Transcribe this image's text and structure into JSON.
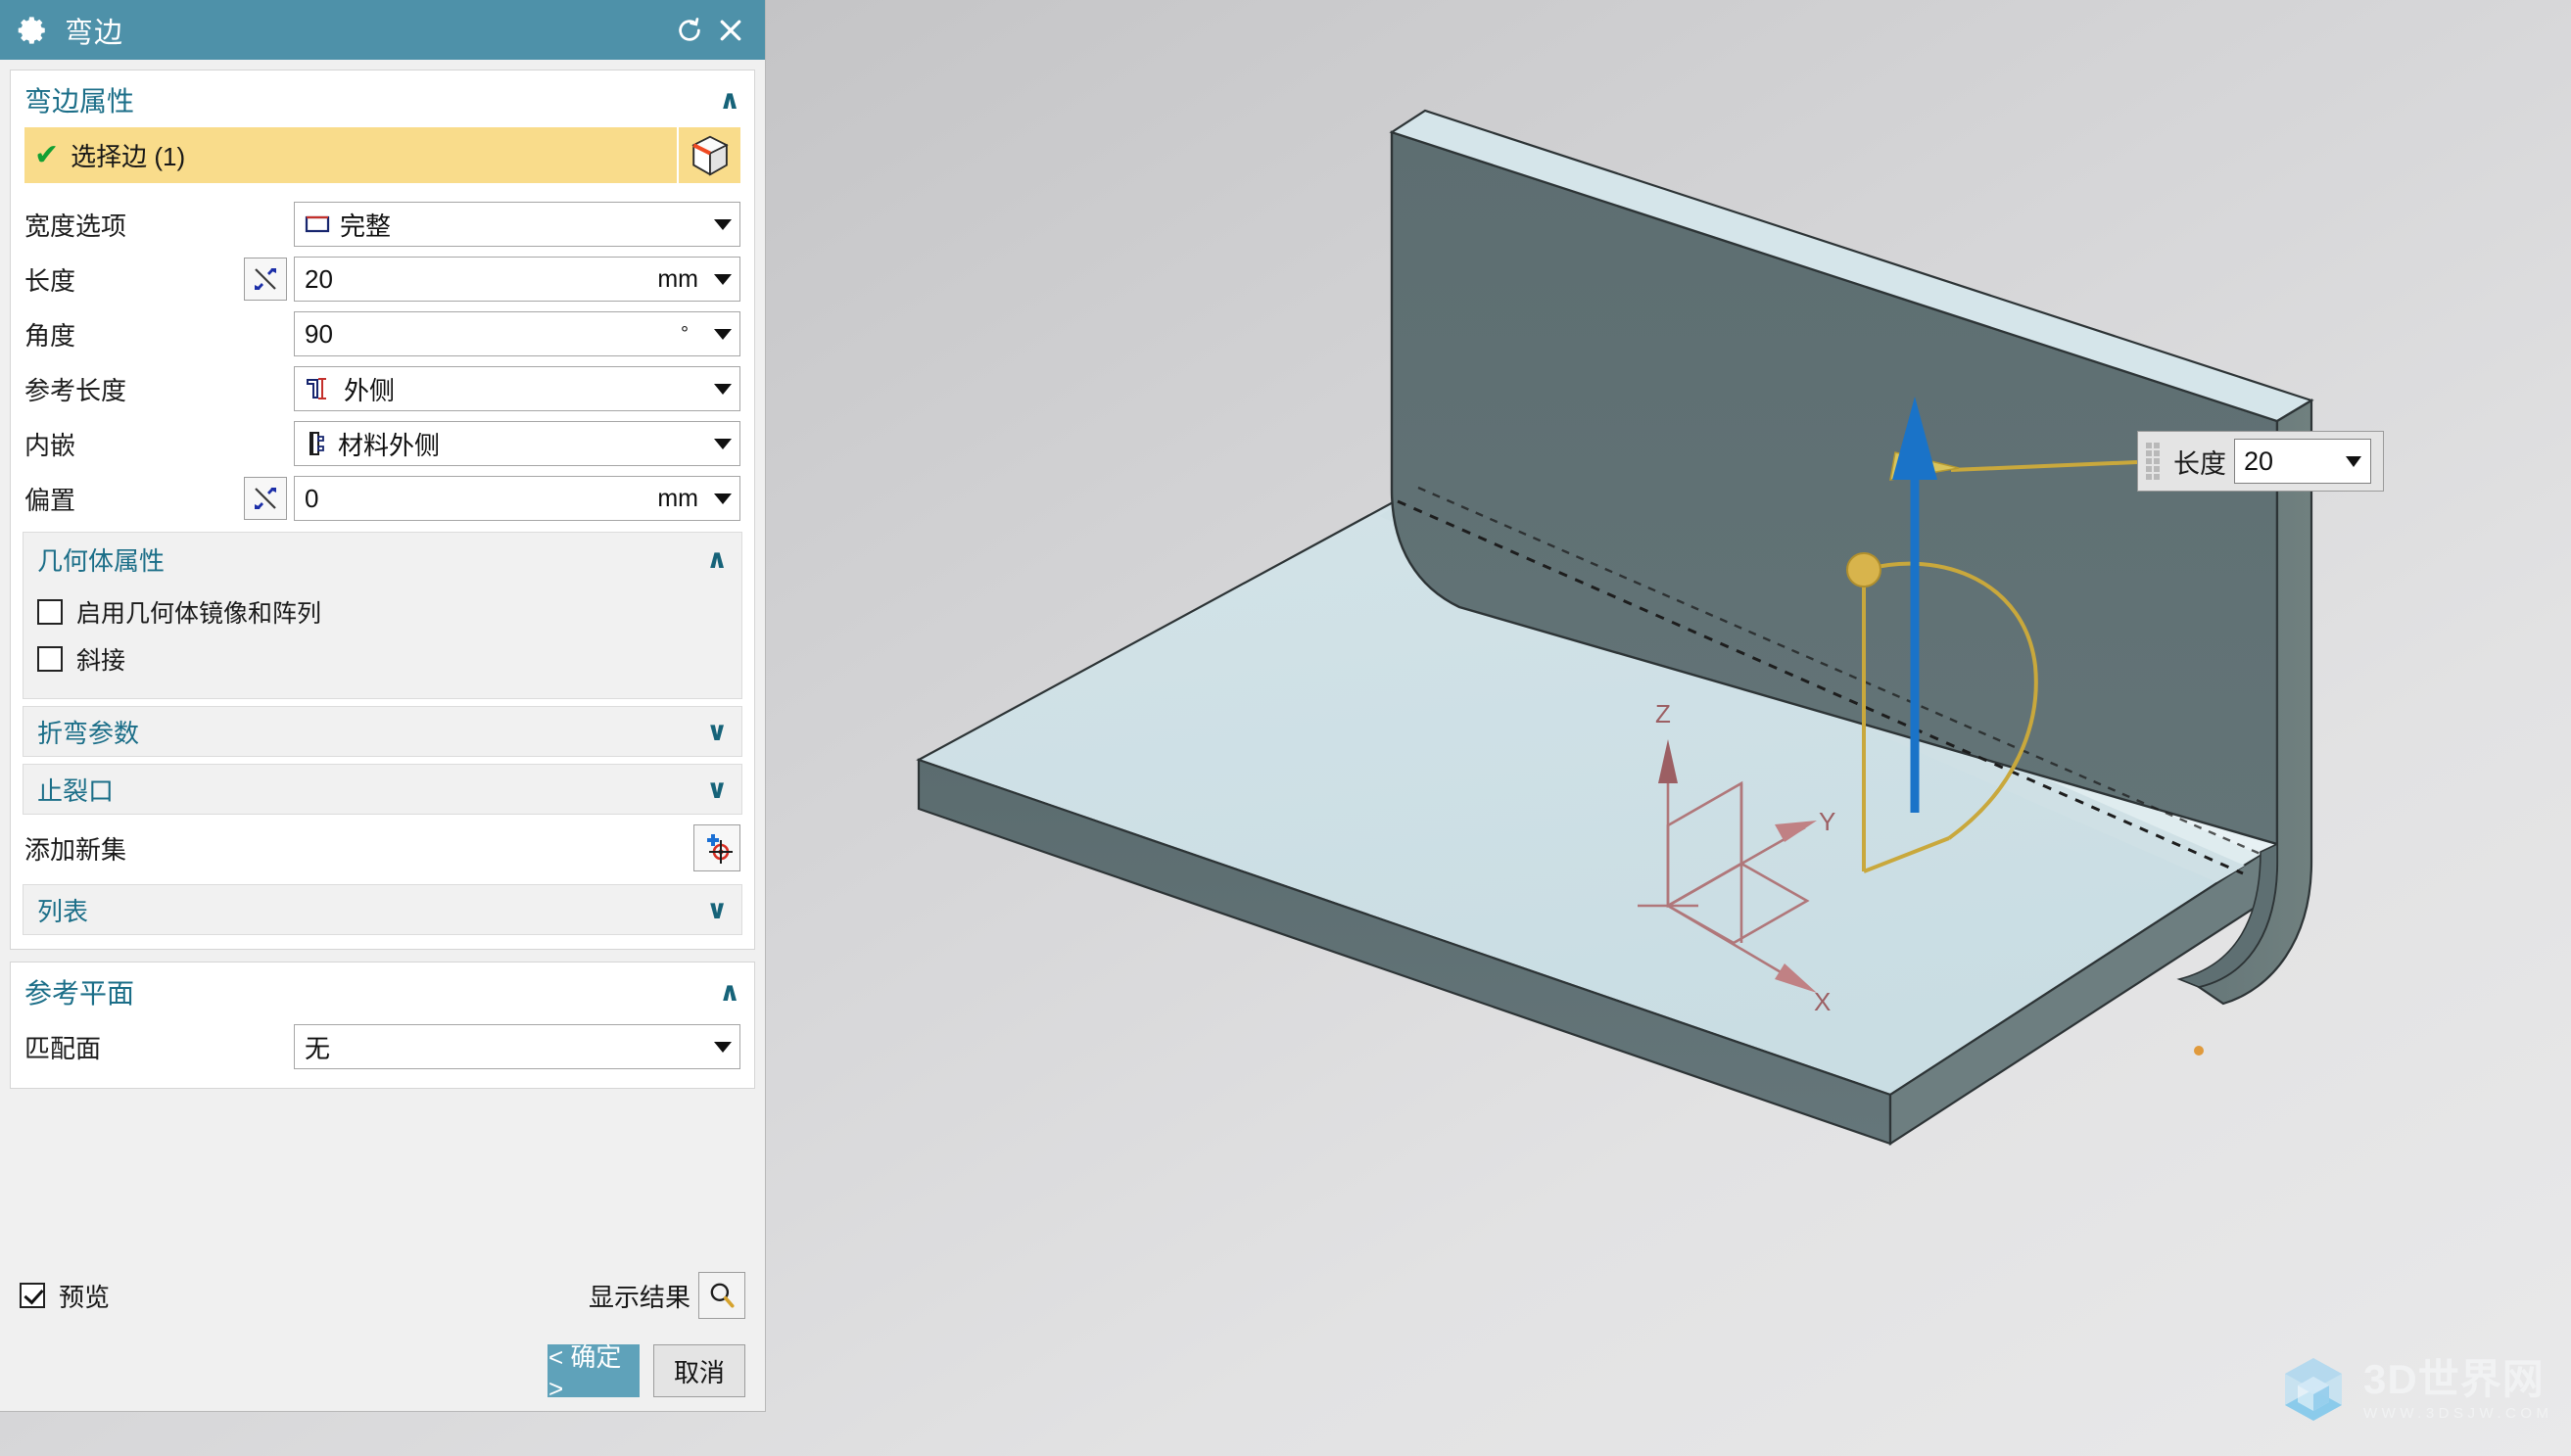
{
  "dialog": {
    "title": "弯边",
    "icons": {
      "app": "gear-icon",
      "reset": "reset-icon",
      "close": "close-icon"
    },
    "accent_title_bg": "#4e91a9",
    "accent_section": "#1b6e88",
    "selection_highlight": "#f9dc8b",
    "groups": {
      "flange_properties": {
        "title": "弯边属性",
        "expanded_chevron": "∧",
        "select_edge": {
          "label": "选择边 (1)",
          "status_icon": "check-icon",
          "picker_icon": "select-edge-cube-icon"
        },
        "fields": [
          {
            "label": "宽度选项",
            "value": "完整",
            "unit": "",
            "icon": "width-full-icon",
            "has_reverse": false,
            "type": "select"
          },
          {
            "label": "长度",
            "value": "20",
            "unit": "mm",
            "icon": "",
            "has_reverse": true,
            "type": "measure"
          },
          {
            "label": "角度",
            "value": "90",
            "unit": "°",
            "icon": "",
            "has_reverse": false,
            "type": "measure"
          },
          {
            "label": "参考长度",
            "value": "外侧",
            "unit": "",
            "icon": "reference-outside-icon",
            "has_reverse": false,
            "type": "select"
          },
          {
            "label": "内嵌",
            "value": "材料外侧",
            "unit": "",
            "icon": "inset-material-outside-icon",
            "has_reverse": false,
            "type": "select"
          },
          {
            "label": "偏置",
            "value": "0",
            "unit": "mm",
            "icon": "",
            "has_reverse": true,
            "type": "measure"
          }
        ],
        "geometry_properties": {
          "title": "几何体属性",
          "chevron": "∧",
          "checkboxes": [
            {
              "label": "启用几何体镜像和阵列",
              "checked": false
            },
            {
              "label": "斜接",
              "checked": false
            }
          ]
        },
        "collapsed_sections": [
          {
            "title": "折弯参数",
            "chevron": "∨"
          },
          {
            "title": "止裂口",
            "chevron": "∨"
          }
        ],
        "add_new_set": {
          "label": "添加新集",
          "icon": "add-new-set-icon"
        },
        "list_section": {
          "title": "列表",
          "chevron": "∨"
        }
      },
      "reference_plane": {
        "title": "参考平面",
        "chevron": "∧",
        "fields": [
          {
            "label": "匹配面",
            "value": "无",
            "unit": "",
            "type": "select"
          }
        ]
      }
    },
    "footer": {
      "preview": {
        "label": "预览",
        "checked": true
      },
      "show_result": {
        "label": "显示结果",
        "icon": "magnifier-icon"
      },
      "buttons": {
        "ok": "< 确定 >",
        "cancel": "取消"
      }
    }
  },
  "viewport": {
    "background_top": "#bcbcbe",
    "background_bottom": "#e9e9ea",
    "part_face_color": "#cfe2e8",
    "part_side_color": "#5f7073",
    "handle": {
      "label": "长度",
      "value": "20",
      "grip_icon": "drag-grip-icon",
      "caret_icon": "chevron-down-icon"
    },
    "csys": {
      "x_label": "X",
      "y_label": "Y",
      "z_label": "Z",
      "color": "#b0777a"
    },
    "manipulators": {
      "length_arrow_color": "#1a73c8",
      "angle_arc_color": "#c9a83c"
    },
    "watermark": {
      "main": "3D世界网",
      "sub": "WWW.3DSJW.COM"
    }
  }
}
